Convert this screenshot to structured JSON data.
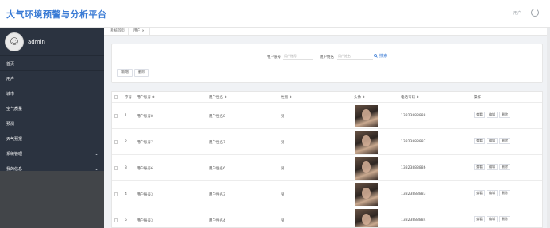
{
  "header": {
    "app_title": "大气环境预警与分析平台",
    "right_label": "用户",
    "logout_icon": "power-icon"
  },
  "sidebar": {
    "username": "admin",
    "avatar_glyph": "☺",
    "items": [
      {
        "label": "首页",
        "chevron": ""
      },
      {
        "label": "用户",
        "chevron": ""
      },
      {
        "label": "城市",
        "chevron": ""
      },
      {
        "label": "空气质量",
        "chevron": ""
      },
      {
        "label": "预测",
        "chevron": ""
      },
      {
        "label": "天气预报",
        "chevron": ""
      },
      {
        "label": "系统管理",
        "chevron": "⌄"
      },
      {
        "label": "我的信息",
        "chevron": "⌄"
      }
    ]
  },
  "tabs": [
    {
      "label": "系统首页"
    },
    {
      "label": "用户  ×"
    }
  ],
  "search": {
    "account_label": "用户账号",
    "account_placeholder": "用户账号",
    "name_label": "用户姓名",
    "name_placeholder": "用户姓名",
    "search_label": "搜索",
    "add_label": "新增",
    "delete_label": "删除"
  },
  "table": {
    "headers": [
      "序号",
      "用户账号 ⇕",
      "用户姓名 ⇕",
      "性别 ⇕",
      "头像 ⇕",
      "电话号码 ⇕",
      "操作"
    ],
    "rows": [
      {
        "index": "1",
        "account": "用户账号8",
        "name": "用户姓名8",
        "gender": "男",
        "phone": "13823888888"
      },
      {
        "index": "2",
        "account": "用户账号7",
        "name": "用户姓名7",
        "gender": "男",
        "phone": "13823888887"
      },
      {
        "index": "3",
        "account": "用户账号6",
        "name": "用户姓名6",
        "gender": "男",
        "phone": "13823888886"
      },
      {
        "index": "4",
        "account": "用户账号3",
        "name": "用户姓名3",
        "gender": "男",
        "phone": "13823888883"
      },
      {
        "index": "5",
        "account": "用户账号3",
        "name": "用户姓名4",
        "gender": "男",
        "phone": "13823888884"
      }
    ],
    "actions": {
      "detail": "查看",
      "edit": "编辑",
      "delete": "删除"
    }
  },
  "colors": {
    "accent": "#3a7bd5",
    "sidebar": "#2b3340"
  }
}
